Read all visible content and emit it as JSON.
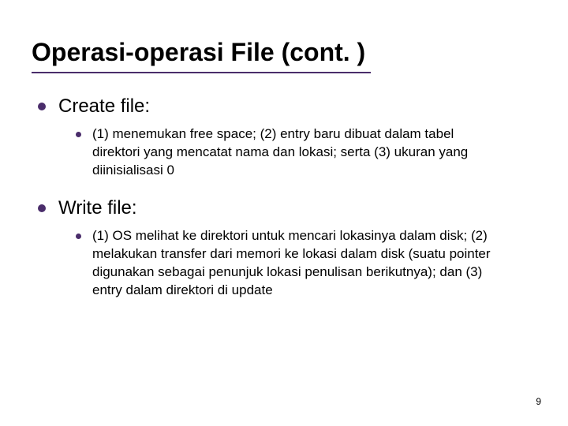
{
  "title": "Operasi-operasi File (cont. )",
  "items": [
    {
      "heading": "Create file:",
      "detail": "(1) menemukan free space; (2) entry baru dibuat dalam tabel direktori yang mencatat nama dan lokasi; serta (3) ukuran yang diinisialisasi 0"
    },
    {
      "heading": "Write file:",
      "detail": "(1) OS melihat ke direktori untuk mencari lokasinya dalam disk; (2) melakukan transfer dari memori ke lokasi dalam disk (suatu pointer digunakan sebagai penunjuk lokasi penulisan berikutnya); dan (3) entry dalam direktori di update"
    }
  ],
  "page_number": "9"
}
